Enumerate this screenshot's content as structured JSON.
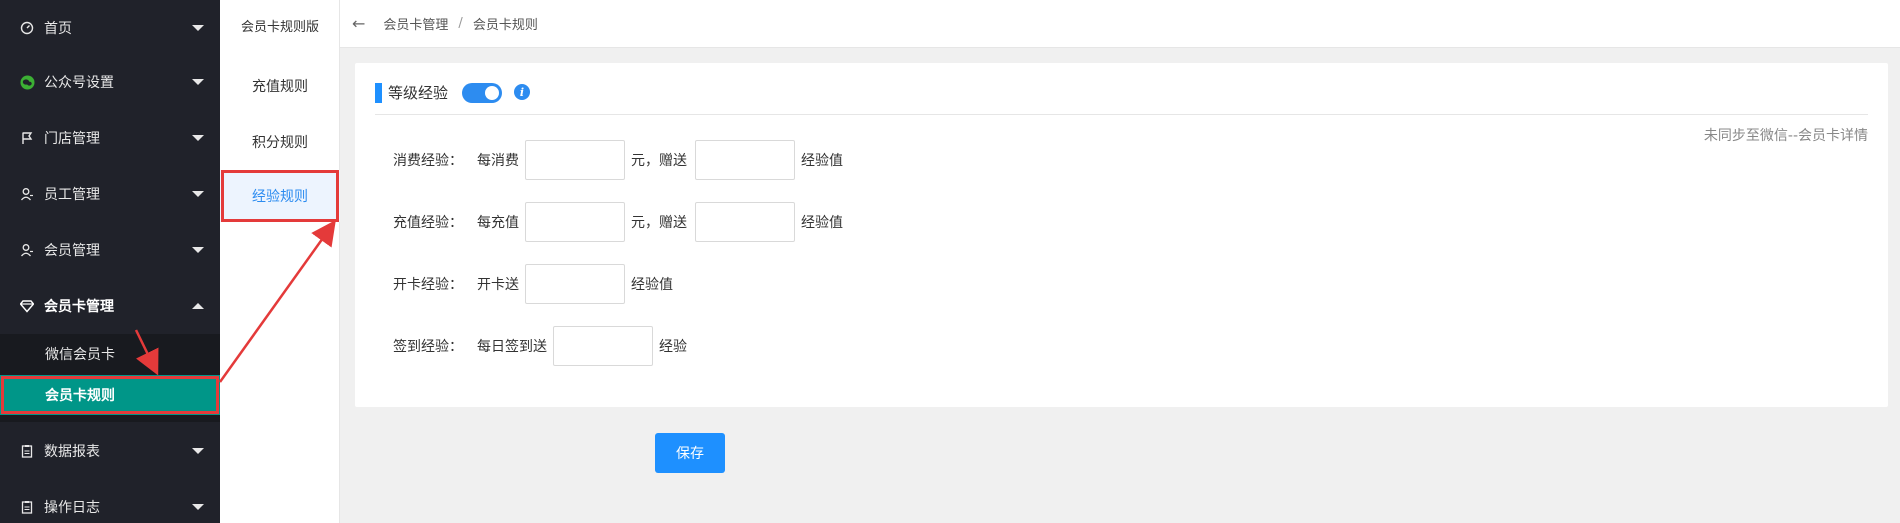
{
  "sidebar": {
    "items": [
      {
        "label": "首页",
        "icon": "dashboard-icon"
      },
      {
        "label": "公众号设置",
        "icon": "wechat-icon"
      },
      {
        "label": "门店管理",
        "icon": "flag-icon"
      },
      {
        "label": "员工管理",
        "icon": "user-icon"
      },
      {
        "label": "会员管理",
        "icon": "user-icon"
      },
      {
        "label": "会员卡管理",
        "icon": "diamond-icon"
      },
      {
        "label": "数据报表",
        "icon": "clipboard-icon"
      },
      {
        "label": "操作日志",
        "icon": "clipboard-icon"
      }
    ],
    "submenu": [
      {
        "label": "微信会员卡"
      },
      {
        "label": "会员卡规则"
      }
    ]
  },
  "secondary_menu": {
    "title": "会员卡规则版",
    "items": [
      {
        "label": "充值规则"
      },
      {
        "label": "积分规则"
      },
      {
        "label": "经验规则"
      }
    ]
  },
  "breadcrumb": {
    "back": "←",
    "parent": "会员卡管理",
    "separator": "/",
    "current": "会员卡规则"
  },
  "card": {
    "title": "等级经验",
    "toggle_on": true,
    "info": "i",
    "sync_note": "未同步至微信--会员卡详情",
    "rows": {
      "consume": {
        "label": "消费经验：",
        "prefix": "每消费",
        "mid": "元，赠送",
        "suffix": "经验值",
        "value1": "",
        "value2": ""
      },
      "recharge": {
        "label": "充值经验：",
        "prefix": "每充值",
        "mid": "元，赠送",
        "suffix": "经验值",
        "value1": "",
        "value2": ""
      },
      "opencard": {
        "label": "开卡经验：",
        "prefix": "开卡送",
        "suffix": "经验值",
        "value1": ""
      },
      "signin": {
        "label": "签到经验：",
        "prefix": "每日签到送",
        "suffix": "经验",
        "value1": ""
      }
    }
  },
  "save_label": "保存",
  "colors": {
    "sidebar_bg": "#20222a",
    "active_green": "#009688",
    "primary_blue": "#1e90ff",
    "highlight_red": "#e43a3a"
  }
}
